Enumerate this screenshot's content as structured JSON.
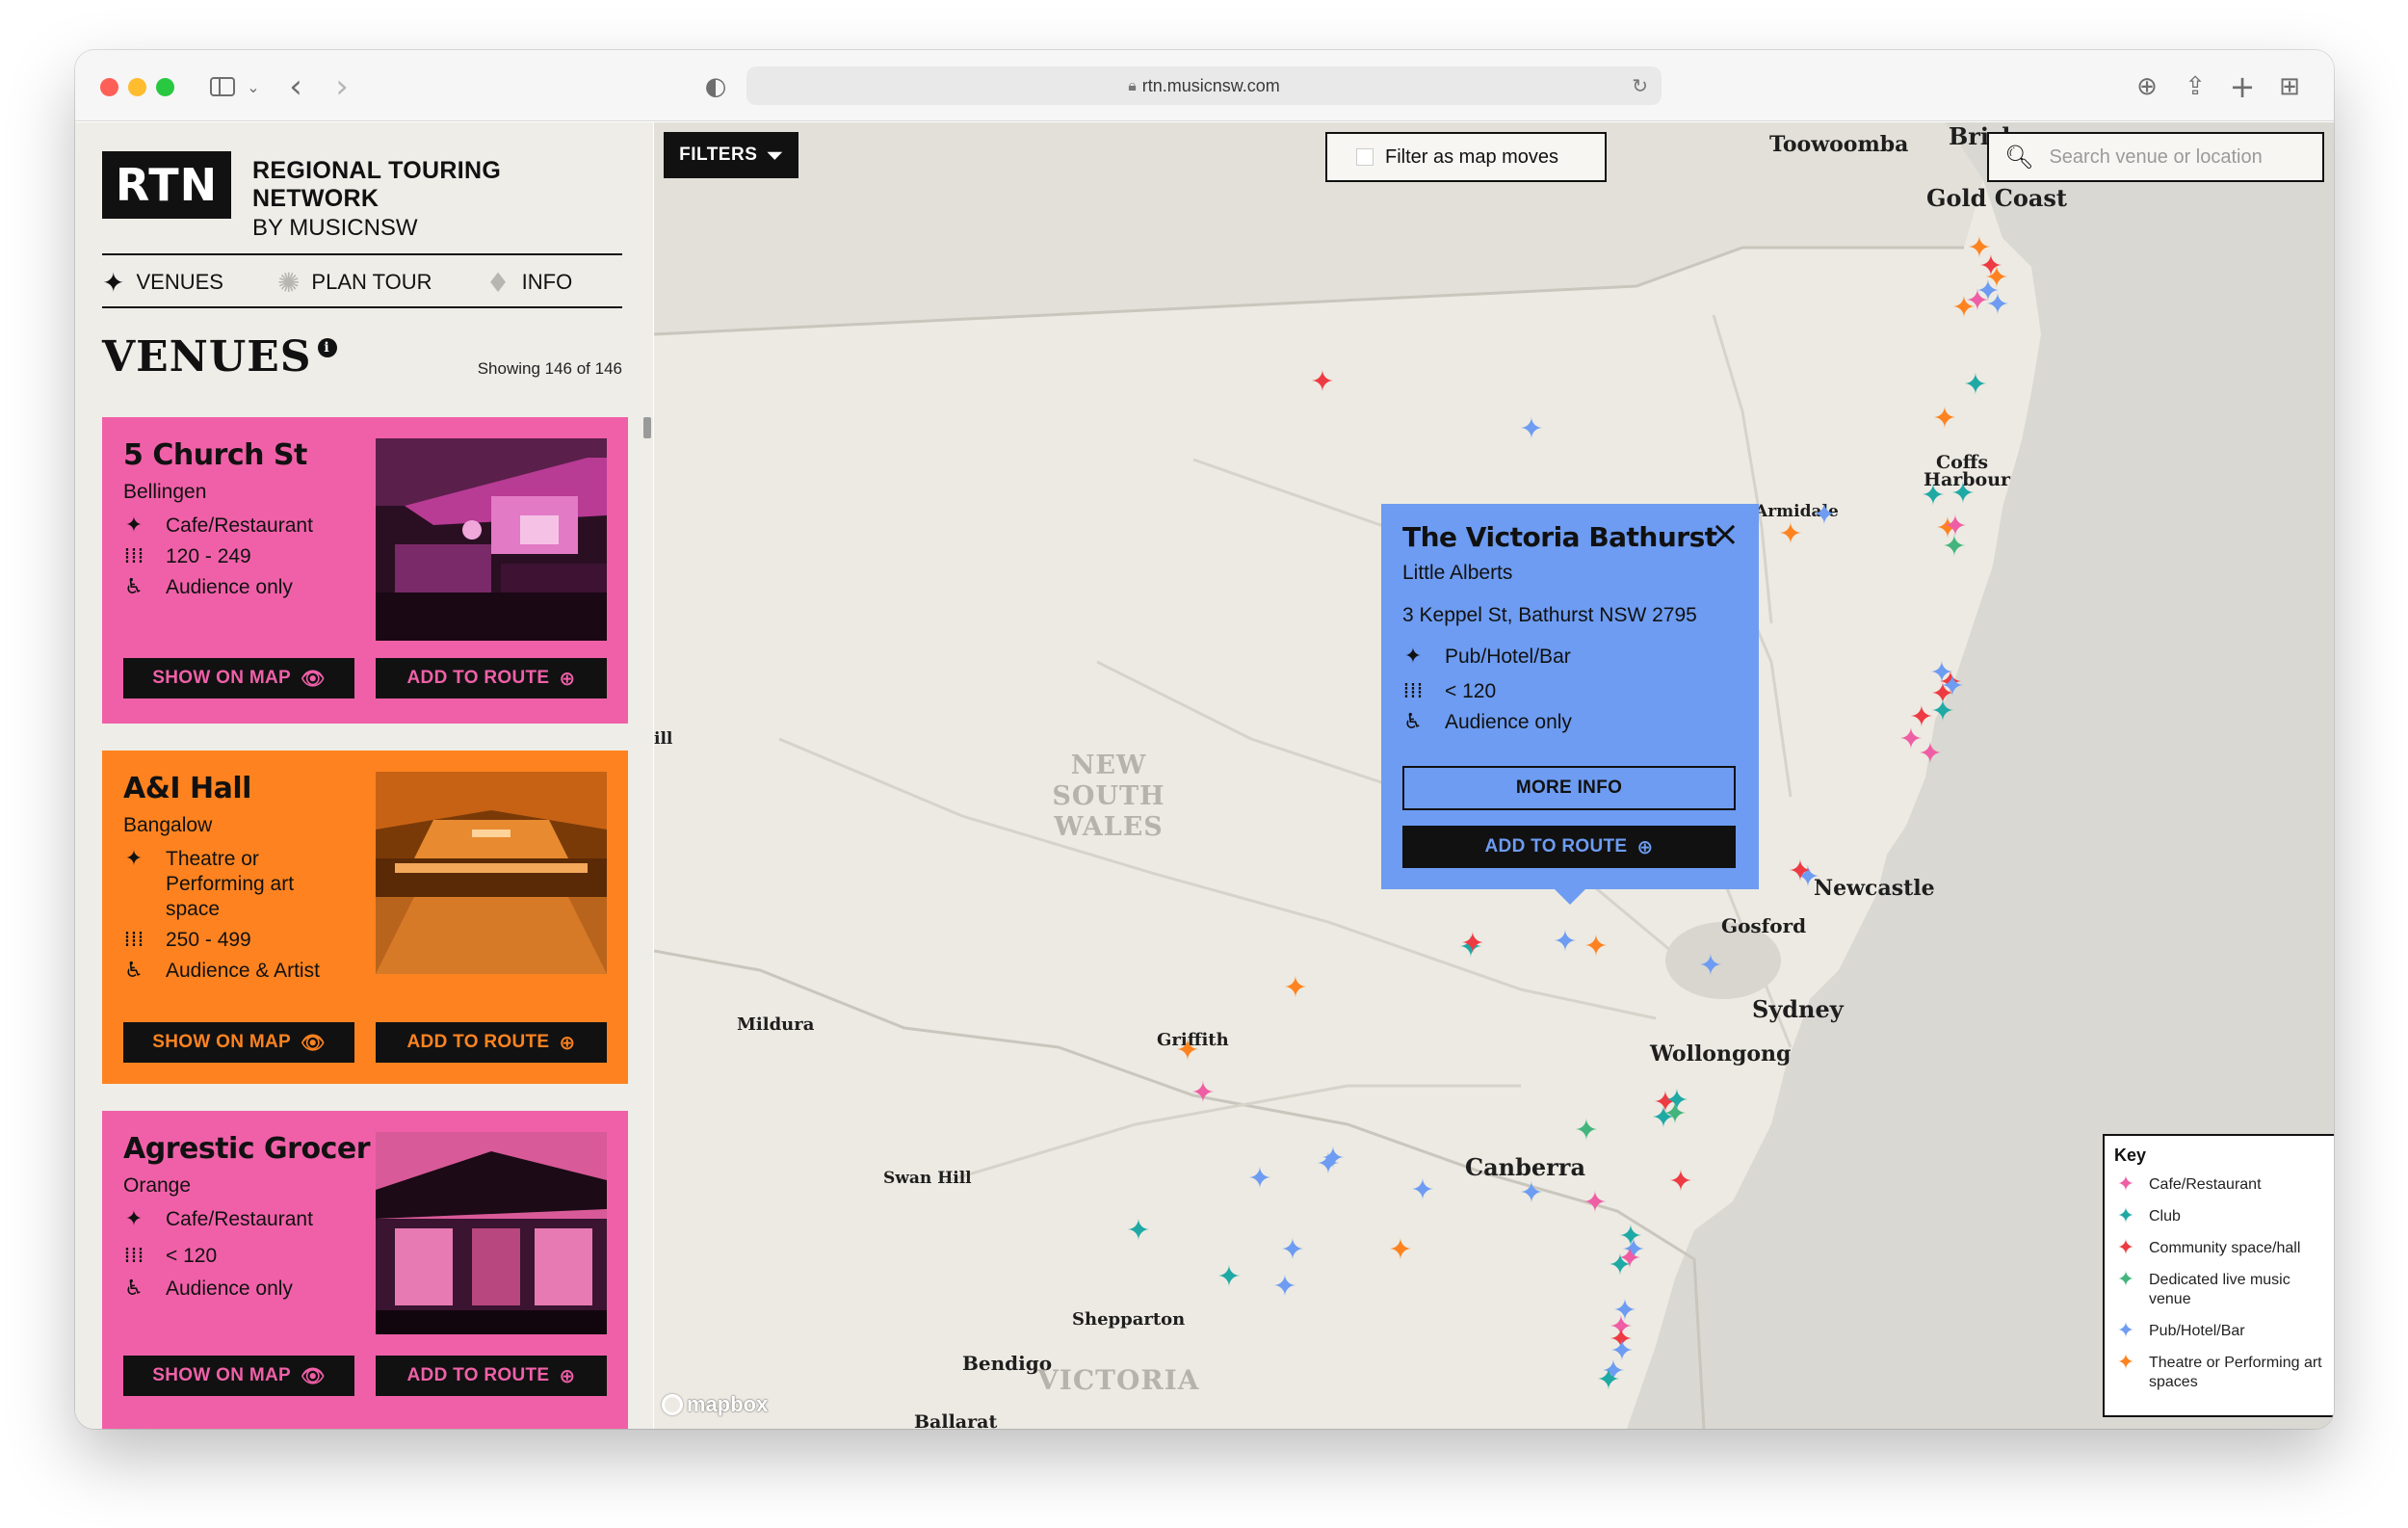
{
  "browser": {
    "url": "rtn.musicnsw.com"
  },
  "brand": {
    "logo": "RTN",
    "line1": "REGIONAL TOURING NETWORK",
    "line2": "BY MUSICNSW"
  },
  "nav": [
    {
      "label": "VENUES",
      "icon": "star-icon",
      "active": true
    },
    {
      "label": "PLAN TOUR",
      "icon": "burst-icon",
      "active": false
    },
    {
      "label": "INFO",
      "icon": "diamond-icon",
      "active": false
    }
  ],
  "venues_heading": "VENUES",
  "showing": "Showing 146 of 146",
  "cards": [
    {
      "title": "5 Church St",
      "town": "Bellingen",
      "type": "Cafe/Restaurant",
      "capacity": "120 - 249",
      "access": "Audience only",
      "show_label": "SHOW ON MAP",
      "add_label": "ADD TO ROUTE",
      "color": "#f060a8"
    },
    {
      "title": "A&I Hall",
      "town": "Bangalow",
      "type": "Theatre or Performing art space",
      "capacity": "250 - 499",
      "access": "Audience & Artist",
      "show_label": "SHOW ON MAP",
      "add_label": "ADD TO ROUTE",
      "color": "#fe8320"
    },
    {
      "title": "Agrestic Grocer",
      "town": "Orange",
      "type": "Cafe/Restaurant",
      "capacity": "< 120",
      "access": "Audience only",
      "show_label": "SHOW ON MAP",
      "add_label": "ADD TO ROUTE",
      "color": "#f060a8"
    }
  ],
  "map": {
    "filters_label": "FILTERS",
    "filter_moves_label": "Filter as map moves",
    "search_placeholder": "Search venue or location",
    "labels": {
      "toowoomba": "Toowoomba",
      "brisbane": "Brisbane",
      "gold_coast": "Gold Coast",
      "coffs_harbour": "Coffs Harbour",
      "armidale": "Armidale",
      "newcastle": "Newcastle",
      "gosford": "Gosford",
      "sydney": "Sydney",
      "wollongong": "Wollongong",
      "canberra": "Canberra",
      "griffith": "Griffith",
      "mildura": "Mildura",
      "swan_hill": "Swan Hill",
      "shepparton": "Shepparton",
      "bendigo": "Bendigo",
      "ballarat": "Ballarat",
      "ill": "ill"
    },
    "state_nsw": "NEW SOUTH WALES",
    "state_vic": "VICTORIA",
    "mapbox": "mapbox"
  },
  "popup": {
    "title": "The Victoria Bathurst",
    "subtitle": "Little Alberts",
    "address": "3 Keppel St, Bathurst NSW 2795",
    "type": "Pub/Hotel/Bar",
    "capacity": "< 120",
    "access": "Audience only",
    "more_info": "MORE INFO",
    "add_route": "ADD TO ROUTE"
  },
  "legend": {
    "title": "Key",
    "items": [
      {
        "label": "Cafe/Restaurant",
        "color": "#ef5ea4"
      },
      {
        "label": "Club",
        "color": "#1fa9a5"
      },
      {
        "label": "Community space/hall",
        "color": "#ee3b43"
      },
      {
        "label": "Dedicated live music venue",
        "color": "#43b57c"
      },
      {
        "label": "Pub/Hotel/Bar",
        "color": "#6d9cf2"
      },
      {
        "label": "Theatre or Performing art spaces",
        "color": "#fe8320"
      }
    ]
  },
  "marker_colors": {
    "cafe": "#ef5ea4",
    "club": "#1fa9a5",
    "community": "#ee3b43",
    "live": "#43b57c",
    "pub": "#6d9cf2",
    "theatre": "#fe8320"
  }
}
